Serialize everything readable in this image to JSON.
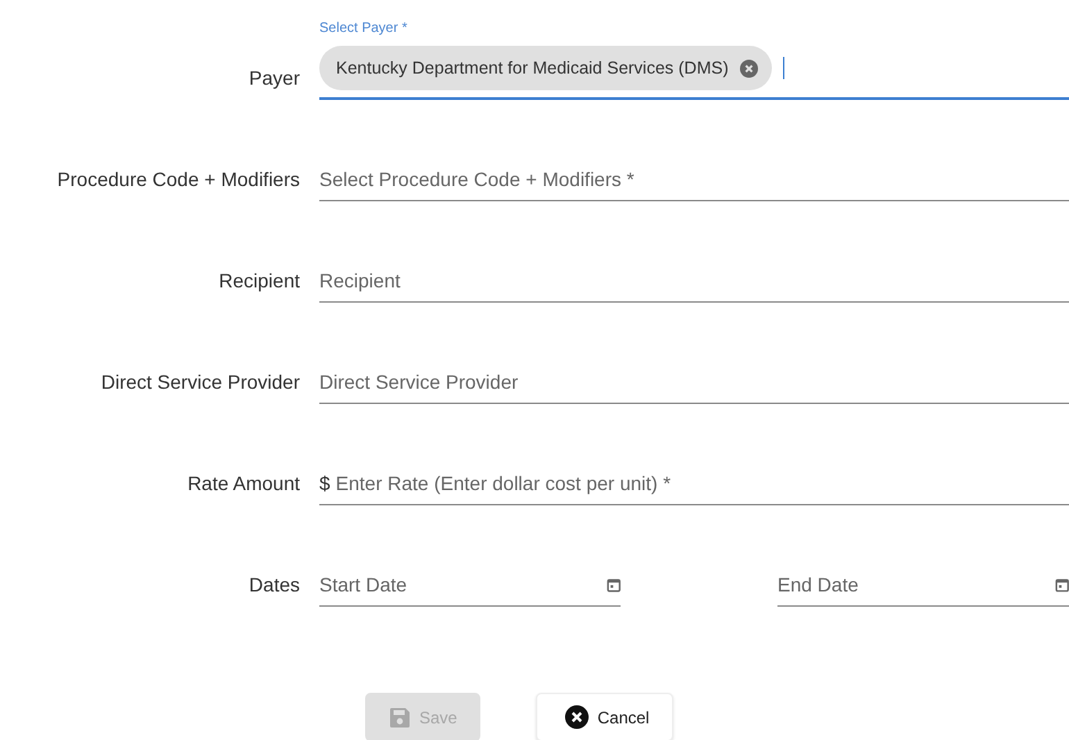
{
  "fields": [
    {
      "kind": "chip",
      "label": "Payer",
      "floating_label": "Select Payer *",
      "chip": "Kentucky Department for Medicaid Services (DMS)",
      "focused": true
    },
    {
      "kind": "text",
      "label": "Procedure Code + Modifiers",
      "placeholder": "Select Procedure Code + Modifiers *"
    },
    {
      "kind": "text",
      "label": "Recipient",
      "placeholder": "Recipient"
    },
    {
      "kind": "text",
      "label": "Direct Service Provider",
      "placeholder": "Direct Service Provider"
    },
    {
      "kind": "money",
      "label": "Rate Amount",
      "prefix": "$",
      "placeholder": "Enter Rate (Enter dollar cost per unit) *"
    },
    {
      "kind": "dates",
      "label": "Dates",
      "start_placeholder": "Start Date",
      "end_placeholder": "End Date"
    }
  ],
  "buttons": [
    {
      "kind": "save",
      "label": "Save",
      "disabled": true
    },
    {
      "kind": "cancel",
      "label": "Cancel",
      "disabled": false
    }
  ]
}
